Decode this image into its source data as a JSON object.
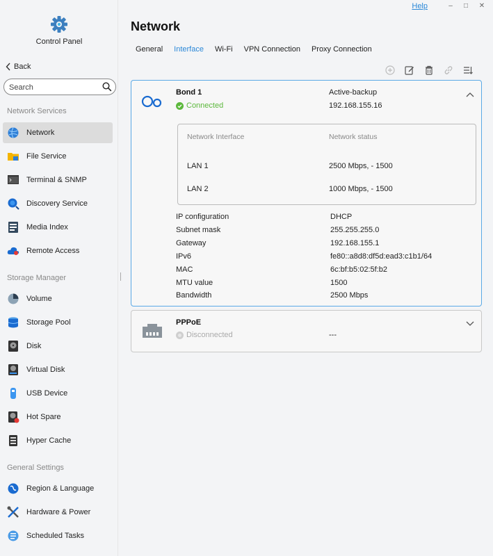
{
  "window": {
    "help_label": "Help",
    "minimize_glyph": "–",
    "maximize_glyph": "□",
    "close_glyph": "✕"
  },
  "sidebar": {
    "app_title": "Control Panel",
    "back_label": "Back",
    "search_placeholder": "Search",
    "sections": [
      {
        "label": "Network Services",
        "items": [
          {
            "label": "Network",
            "icon": "globe-icon",
            "active": true
          },
          {
            "label": "File Service",
            "icon": "folder-icon"
          },
          {
            "label": "Terminal & SNMP",
            "icon": "terminal-icon"
          },
          {
            "label": "Discovery Service",
            "icon": "discovery-icon"
          },
          {
            "label": "Media Index",
            "icon": "media-index-icon"
          },
          {
            "label": "Remote Access",
            "icon": "cloud-icon"
          }
        ]
      },
      {
        "label": "Storage Manager",
        "items": [
          {
            "label": "Volume",
            "icon": "volume-icon"
          },
          {
            "label": "Storage Pool",
            "icon": "storage-pool-icon"
          },
          {
            "label": "Disk",
            "icon": "disk-icon"
          },
          {
            "label": "Virtual Disk",
            "icon": "virtual-disk-icon"
          },
          {
            "label": "USB Device",
            "icon": "usb-icon"
          },
          {
            "label": "Hot Spare",
            "icon": "hot-spare-icon"
          },
          {
            "label": "Hyper Cache",
            "icon": "hyper-cache-icon"
          }
        ]
      },
      {
        "label": "General Settings",
        "items": [
          {
            "label": "Region & Language",
            "icon": "region-globe-icon"
          },
          {
            "label": "Hardware & Power",
            "icon": "tools-icon"
          },
          {
            "label": "Scheduled Tasks",
            "icon": "tasks-icon"
          }
        ]
      }
    ]
  },
  "main": {
    "title": "Network",
    "tabs": [
      {
        "label": "General",
        "active": false
      },
      {
        "label": "Interface",
        "active": true
      },
      {
        "label": "Wi-Fi",
        "active": false
      },
      {
        "label": "VPN Connection",
        "active": false
      },
      {
        "label": "Proxy Connection",
        "active": false
      }
    ],
    "toolbar": [
      "add-icon",
      "edit-icon",
      "delete-icon",
      "link-icon",
      "sort-icon"
    ],
    "interfaces": [
      {
        "name": "Bond 1",
        "status": "Connected",
        "mode": "Active-backup",
        "ip": "192.168.155.16",
        "table_headers": [
          "Network Interface",
          "Network status"
        ],
        "members": [
          {
            "name": "LAN 1",
            "status": "2500 Mbps, - 1500"
          },
          {
            "name": "LAN 2",
            "status": "1000 Mbps, - 1500"
          }
        ],
        "details": [
          {
            "label": "IP configuration",
            "value": "DHCP"
          },
          {
            "label": "Subnet mask",
            "value": "255.255.255.0"
          },
          {
            "label": "Gateway",
            "value": "192.168.155.1"
          },
          {
            "label": "IPv6",
            "value": "fe80::a8d8:df5d:ead3:c1b1/64"
          },
          {
            "label": "MAC",
            "value": "6c:bf:b5:02:5f:b2"
          },
          {
            "label": "MTU value",
            "value": "1500"
          },
          {
            "label": "Bandwidth",
            "value": "2500 Mbps"
          }
        ]
      },
      {
        "name": "PPPoE",
        "status": "Disconnected",
        "ip": "---"
      }
    ]
  },
  "colors": {
    "accent": "#2b88d8",
    "connected": "#5cb83c",
    "disconnected": "#c8c8c8"
  }
}
